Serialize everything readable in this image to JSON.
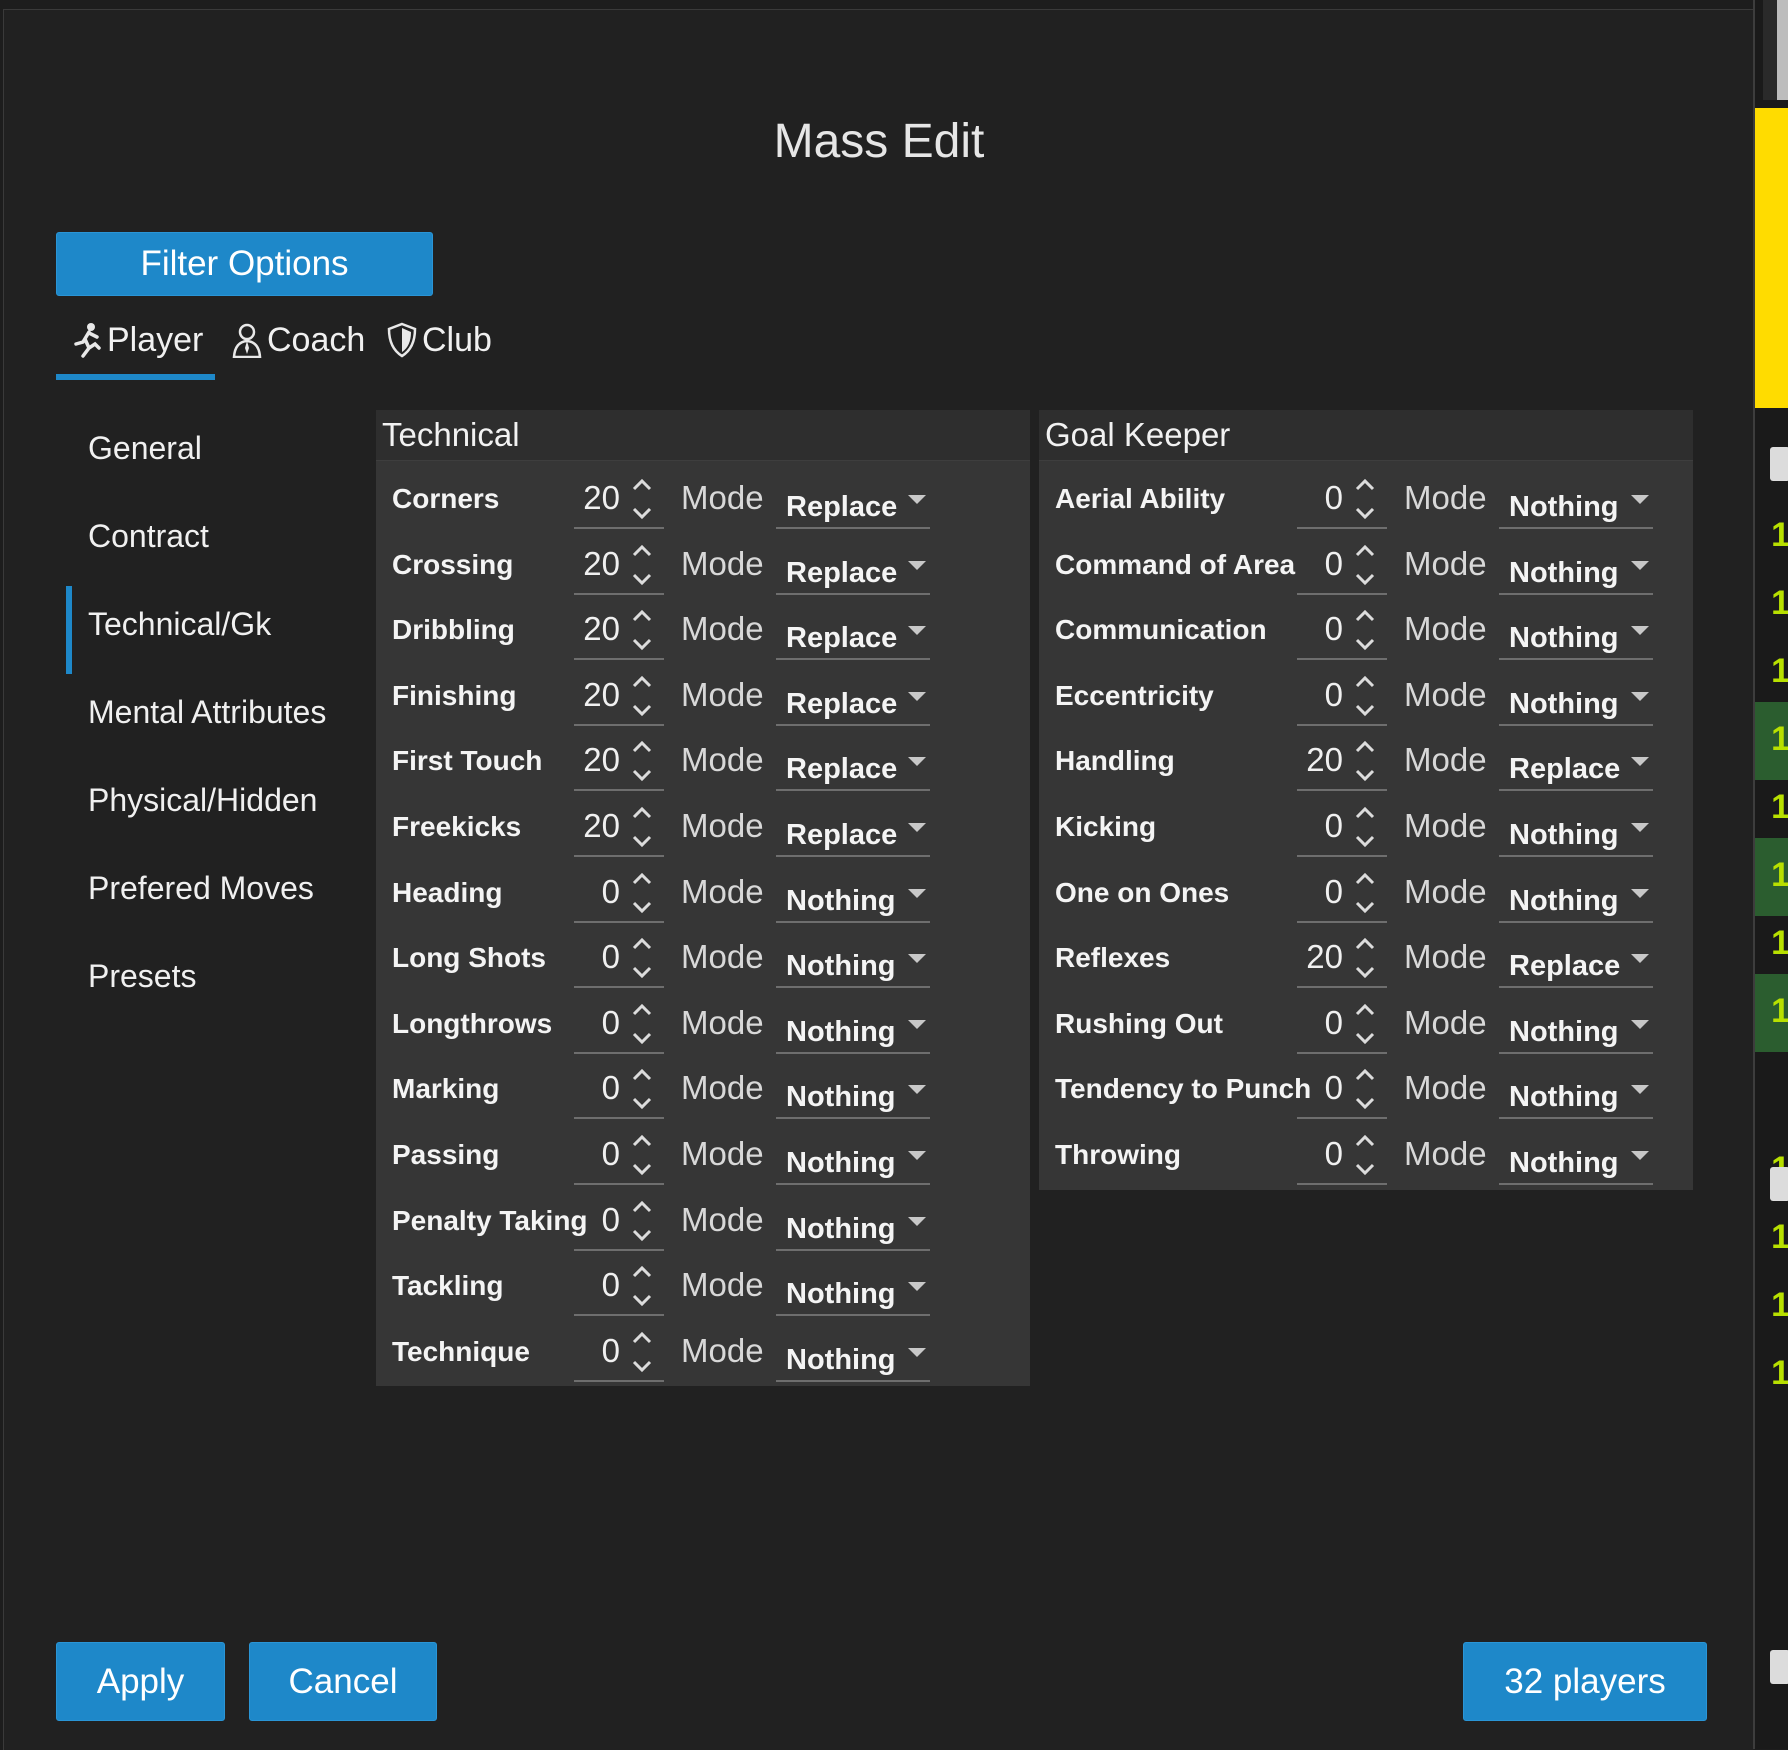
{
  "dialog": {
    "title": "Mass Edit"
  },
  "filter_options_label": "Filter Options",
  "tabs": [
    {
      "label": "Player",
      "icon": "player-icon",
      "active": true
    },
    {
      "label": "Coach",
      "icon": "coach-icon",
      "active": false
    },
    {
      "label": "Club",
      "icon": "shield-icon",
      "active": false
    }
  ],
  "sidenav": [
    {
      "label": "General",
      "active": false
    },
    {
      "label": "Contract",
      "active": false
    },
    {
      "label": "Technical/Gk",
      "active": true
    },
    {
      "label": "Mental Attributes",
      "active": false
    },
    {
      "label": "Physical/Hidden",
      "active": false
    },
    {
      "label": "Prefered Moves",
      "active": false
    },
    {
      "label": "Presets",
      "active": false
    }
  ],
  "mode_label": "Mode",
  "technical": {
    "title": "Technical",
    "rows": [
      {
        "label": "Corners",
        "value": "20",
        "mode": "Replace"
      },
      {
        "label": "Crossing",
        "value": "20",
        "mode": "Replace"
      },
      {
        "label": "Dribbling",
        "value": "20",
        "mode": "Replace"
      },
      {
        "label": "Finishing",
        "value": "20",
        "mode": "Replace"
      },
      {
        "label": "First Touch",
        "value": "20",
        "mode": "Replace"
      },
      {
        "label": "Freekicks",
        "value": "20",
        "mode": "Replace"
      },
      {
        "label": "Heading",
        "value": "0",
        "mode": "Nothing"
      },
      {
        "label": "Long Shots",
        "value": "0",
        "mode": "Nothing"
      },
      {
        "label": "Longthrows",
        "value": "0",
        "mode": "Nothing"
      },
      {
        "label": "Marking",
        "value": "0",
        "mode": "Nothing"
      },
      {
        "label": "Passing",
        "value": "0",
        "mode": "Nothing"
      },
      {
        "label": "Penalty Taking",
        "value": "0",
        "mode": "Nothing"
      },
      {
        "label": "Tackling",
        "value": "0",
        "mode": "Nothing"
      },
      {
        "label": "Technique",
        "value": "0",
        "mode": "Nothing"
      }
    ]
  },
  "goalkeeper": {
    "title": "Goal Keeper",
    "rows": [
      {
        "label": "Aerial Ability",
        "value": "0",
        "mode": "Nothing"
      },
      {
        "label": "Command of Area",
        "value": "0",
        "mode": "Nothing"
      },
      {
        "label": "Communication",
        "value": "0",
        "mode": "Nothing"
      },
      {
        "label": "Eccentricity",
        "value": "0",
        "mode": "Nothing"
      },
      {
        "label": "Handling",
        "value": "20",
        "mode": "Replace"
      },
      {
        "label": "Kicking",
        "value": "0",
        "mode": "Nothing"
      },
      {
        "label": "One on Ones",
        "value": "0",
        "mode": "Nothing"
      },
      {
        "label": "Reflexes",
        "value": "20",
        "mode": "Replace"
      },
      {
        "label": "Rushing Out",
        "value": "0",
        "mode": "Nothing"
      },
      {
        "label": "Tendency to Punch",
        "value": "0",
        "mode": "Nothing"
      },
      {
        "label": "Throwing",
        "value": "0",
        "mode": "Nothing"
      }
    ]
  },
  "footer": {
    "apply_label": "Apply",
    "cancel_label": "Cancel",
    "players_label": "32 players"
  },
  "background_strip": {
    "row_values": [
      "1",
      "1",
      "1",
      "1",
      "1",
      "1",
      "1",
      "1",
      "1",
      "1",
      "1",
      "1"
    ],
    "accent_yellow": "#ffdc00"
  },
  "colors": {
    "accent": "#1e88c9",
    "background": "#212121",
    "panel": "#363636"
  }
}
